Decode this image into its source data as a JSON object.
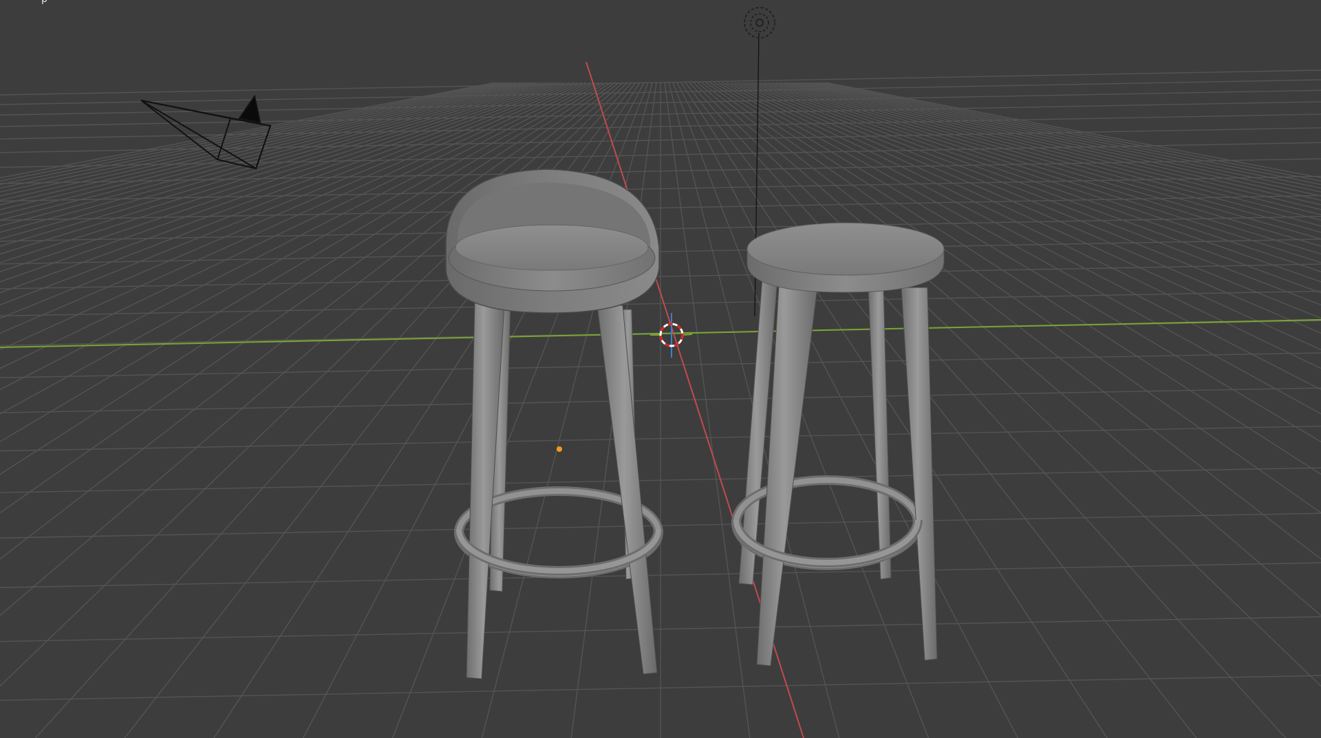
{
  "app": {
    "name": "3D Viewport",
    "view": "perspective",
    "shading": "solid"
  },
  "header_fragment": "p",
  "colors": {
    "background": "#3d3d3d",
    "grid_line": "#545454",
    "x_axis": "#c24a50",
    "y_axis": "#7aa535",
    "z_axis": "#3f7ec7",
    "object_gray": "#8a8a8a",
    "origin_dot": "#f39a1e",
    "wire": "#0a0a0a"
  },
  "scene": {
    "objects": [
      {
        "name": "camera",
        "icon": "camera-wireframe-icon"
      },
      {
        "name": "light",
        "icon": "light-point-icon"
      },
      {
        "name": "stool-with-backrest",
        "icon": "mesh-object"
      },
      {
        "name": "stool-round-seat",
        "icon": "mesh-object"
      },
      {
        "name": "3d-cursor",
        "icon": "crosshair-icon"
      },
      {
        "name": "object-origin",
        "icon": "origin-dot"
      }
    ]
  }
}
